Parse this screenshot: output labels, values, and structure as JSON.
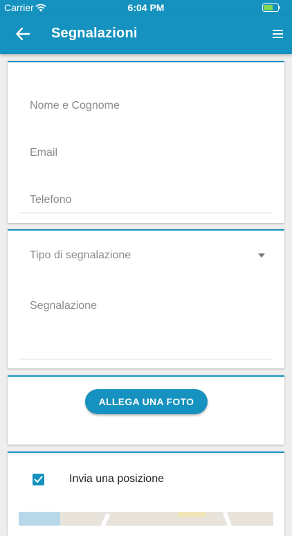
{
  "status_bar": {
    "carrier": "Carrier",
    "time": "6:04 PM"
  },
  "app_bar": {
    "title": "Segnalazioni"
  },
  "form": {
    "name_placeholder": "Nome e Cognome",
    "email_placeholder": "Email",
    "phone_placeholder": "Telefono",
    "report_type_placeholder": "Tipo di segnalazione",
    "report_placeholder": "Segnalazione"
  },
  "attach_photo_label": "ALLEGA UNA FOTO",
  "position": {
    "label": "Invia una posizione",
    "checked": true
  },
  "colors": {
    "primary": "#1592bf",
    "background": "#eeeeee",
    "placeholder": "#8a8a8a"
  },
  "icons": {
    "back": "arrow-left-icon",
    "menu": "hamburger-menu-icon",
    "dropdown": "caret-down-icon",
    "check": "check-icon"
  }
}
